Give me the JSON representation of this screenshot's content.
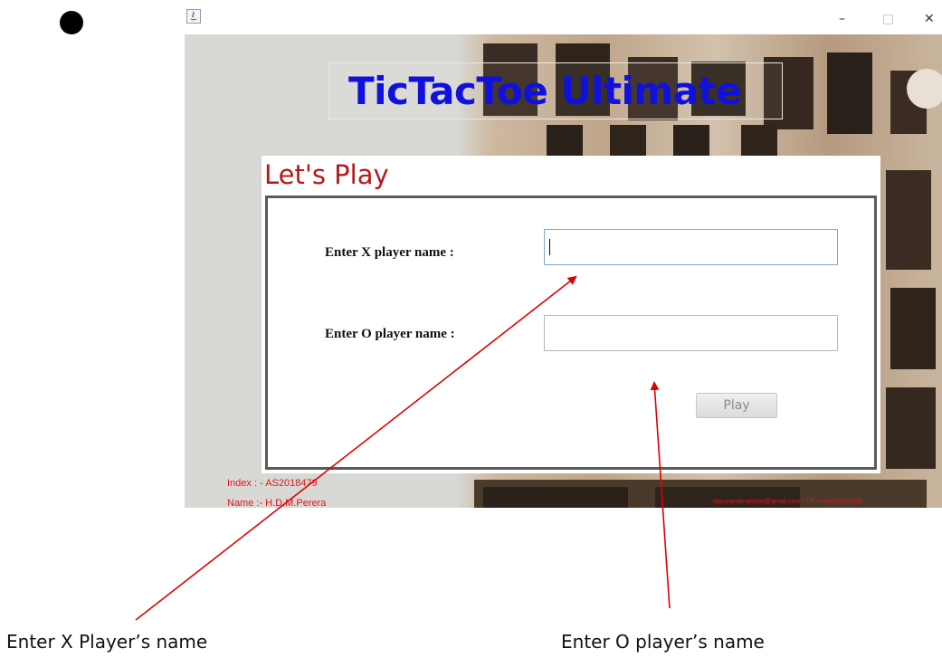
{
  "window": {
    "minimize_glyph": "–",
    "maximize_glyph": "□",
    "close_glyph": "✕",
    "icon": "java-app-icon"
  },
  "app": {
    "logo_text": "TicTacToe Ultimate",
    "panel_title": "Let's Play"
  },
  "form": {
    "x_label": "Enter X player name  :",
    "o_label": "Enter O player name  :",
    "x_value": "",
    "o_value": "",
    "play_label": "Play"
  },
  "footer": {
    "index": "Index : - AS2018479",
    "name": "Name :- H.D.M.Perera",
    "contact": "dasunandmalshan@gmail.com / T.P :-+94754875098"
  },
  "annotations": {
    "x_caption": "Enter X Player’s name",
    "o_caption": "Enter O player’s name",
    "arrow_color": "#e00000"
  },
  "colors": {
    "logo": "#1111dd",
    "panel_title": "#b81818",
    "footer_text": "#e01818"
  }
}
